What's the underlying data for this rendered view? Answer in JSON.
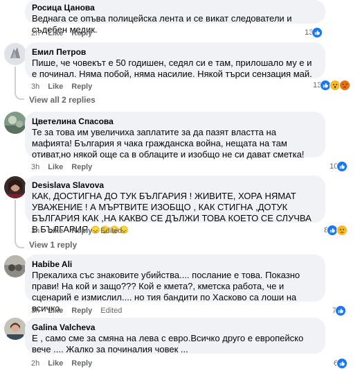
{
  "comments": [
    {
      "author": "Росица Цанова",
      "text": "Веднага се опъва полицейска лента и се викат следователи и съдебен медик.",
      "time": "2h",
      "like_label": "Like",
      "reply_label": "Reply",
      "reaction_count": "13",
      "reactions": [
        "like"
      ]
    },
    {
      "author": "Емил Петров",
      "text": "Пише, че човекът е 50 годишен, седял си е там, прилошало му е и е починал. Няма побой, няма насилие. Някой търси сензация май.",
      "time": "3h",
      "like_label": "Like",
      "reply_label": "Reply",
      "reaction_count": "13",
      "reactions": [
        "like",
        "wow",
        "angry"
      ],
      "replies_label": "View all 2 replies"
    },
    {
      "author": "Цветелина Спасова",
      "text": "Те за това им увеличиха заплатите за да пазят властта на мафията! България я чака гражданска война, нещата на там отиват,но някой още са в облаците и изобщо не си дават сметка!",
      "time": "3h",
      "like_label": "Like",
      "reply_label": "Reply",
      "reaction_count": "10",
      "reactions": [
        "like"
      ]
    },
    {
      "author": "Desislava Slavova",
      "text": "КАК, ДОСТИГНА ДО ТУК БЪЛГАРИЯ ! ЖИВИТЕ, ХОРА НЯМАТ УВАЖЕНИЕ ! А МЪРТВИТЕ ИЗОБЩО , КАК СТИГНА ,ДОТУК БЪЛГАРИЯ КАК ,НА КАКВО СЕ ДЪЛЖИ ТОВА КОЕТО СЕ СЛУЧВА В БЪЛГАРИЯ",
      "emoji": "😞😞😞😞",
      "time": "3h",
      "like_label": "Like",
      "reply_label": "Reply",
      "edited_label": "Edited",
      "reaction_count": "8",
      "reactions": [
        "like",
        "sad"
      ],
      "replies_label": "View 1 reply"
    },
    {
      "author": "Habibe Ali",
      "text": "Прекалиха със знаковите убийства.... послание е това. Показно прави! На кой и защо??? Кой е кмета?, кметска работа, че и сценарий е измислил.... но тия бандити по Хасково са лоши на всичко.",
      "time": "3h",
      "like_label": "Like",
      "reply_label": "Reply",
      "edited_label": "Edited",
      "reaction_count": "7",
      "reactions": [
        "like"
      ]
    },
    {
      "author": "Galina Valcheva",
      "text": "Е , само сме за смяна на лева с евро.Всичко друго е европейско вече .... Жалко за починалия човек ...",
      "time": "2h",
      "like_label": "Like",
      "reply_label": "Reply",
      "reaction_count": "6",
      "reactions": [
        "like"
      ]
    }
  ],
  "colors": {
    "bubble": "#f0f2f5",
    "meta": "#65676b",
    "like_blue": "#1877f2",
    "emoji_yellow": "#f7b928",
    "angry_orange": "#e9710f"
  }
}
